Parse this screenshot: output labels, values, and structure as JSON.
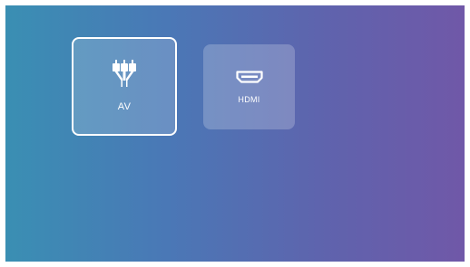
{
  "sources": {
    "items": [
      {
        "label": "AV",
        "icon": "av-plug-icon",
        "selected": true
      },
      {
        "label": "HDMI",
        "icon": "hdmi-port-icon",
        "selected": false
      }
    ]
  }
}
